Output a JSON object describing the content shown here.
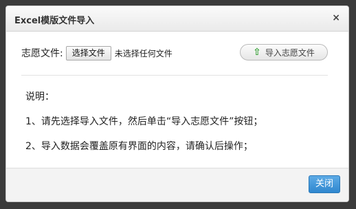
{
  "dialog": {
    "title": "Excel模版文件导入",
    "close_glyph": "×"
  },
  "file_row": {
    "label": "志愿文件:",
    "choose_button": "选择文件",
    "no_file_text": "未选择任何文件"
  },
  "import_button": {
    "icon": "arrow-up-icon",
    "icon_glyph": "⇧",
    "label": "导入志愿文件"
  },
  "description": {
    "heading": "说明：",
    "lines": [
      "1、请先选择导入文件，然后单击“导入志愿文件”按钮；",
      "2、导入数据会覆盖原有界面的内容，请确认后操作；"
    ]
  },
  "footer": {
    "close_button": "关闭"
  },
  "colors": {
    "accent": "#2f87cf",
    "icon_green": "#3aa33a"
  }
}
